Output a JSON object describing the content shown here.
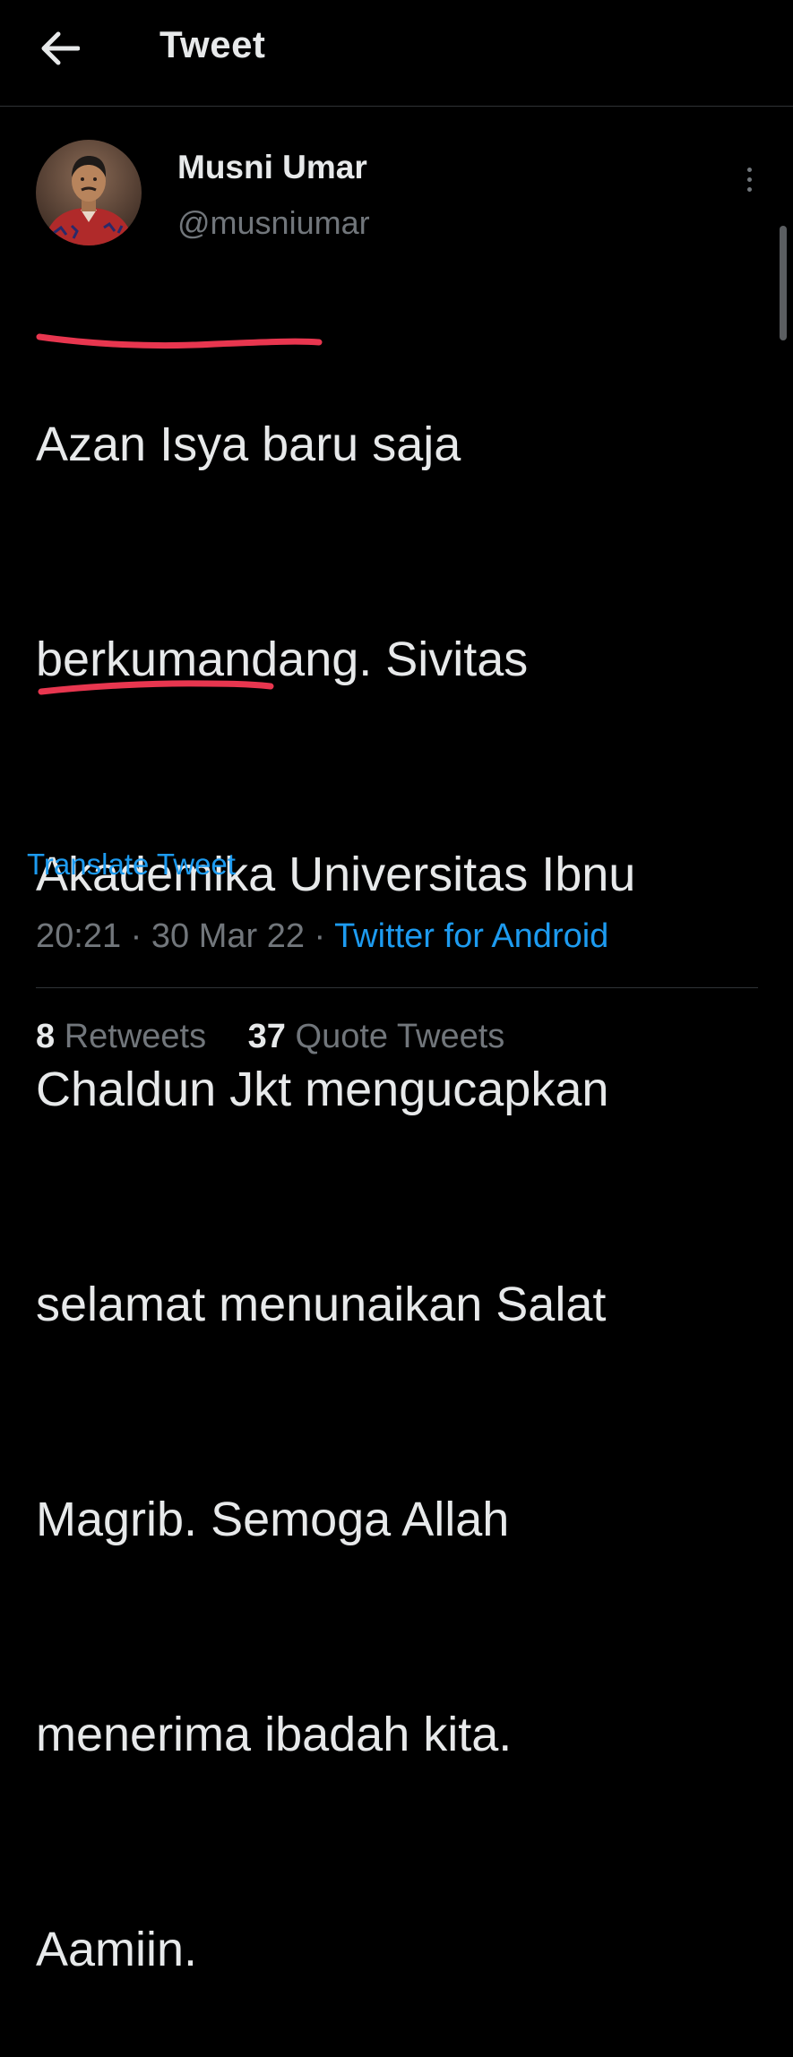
{
  "header": {
    "title": "Tweet",
    "back_icon": "arrow-left-icon"
  },
  "tweet": {
    "author": {
      "name": "Musni Umar",
      "handle": "@musniumar"
    },
    "text_lines": [
      "Azan Isya baru saja",
      "berkumandang. Sivitas",
      "Akademika Universitas Ibnu",
      "Chaldun Jkt mengucapkan",
      "selamat menunaikan Salat",
      "Magrib. Semoga Allah",
      "menerima ibadah kita.",
      "Aamiin."
    ],
    "translate_label": "Translate Tweet",
    "time": "20:21",
    "date": "30 Mar 22",
    "separator": "·",
    "source": "Twitter for Android",
    "stats": {
      "retweets_count": "8",
      "retweets_label": "Retweets",
      "quotes_count": "37",
      "quotes_label": "Quote Tweets"
    }
  },
  "colors": {
    "background": "#000000",
    "text_primary": "#e7e9ea",
    "text_secondary": "#71767b",
    "link": "#1d9bf0",
    "annotation_underline": "#e8364f",
    "divider": "#2f3336"
  },
  "icons": {
    "more": "more-vertical-icon"
  }
}
